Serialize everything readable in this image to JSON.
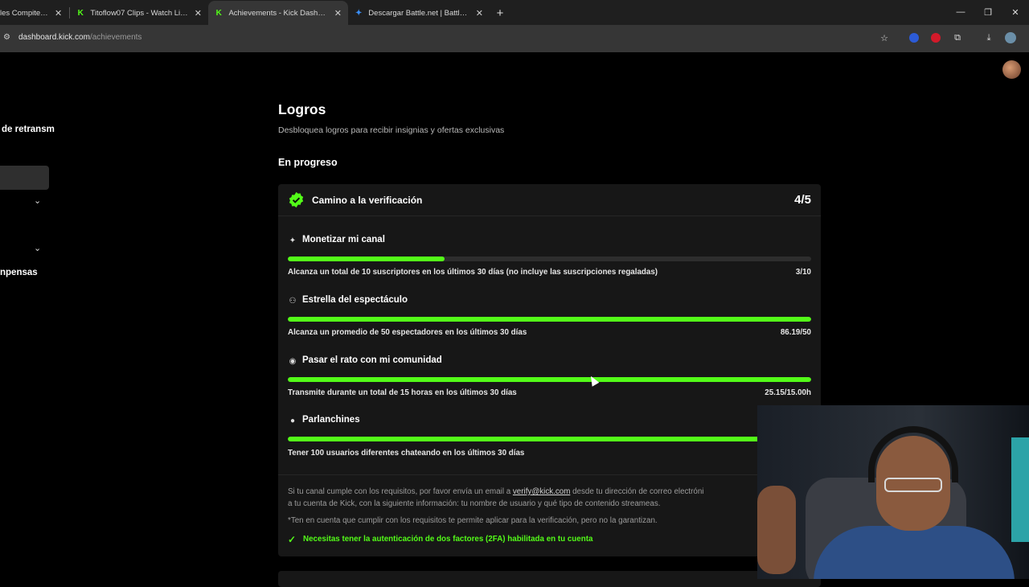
{
  "browser": {
    "tabs": [
      {
        "title": "les Compiten p",
        "active": false
      },
      {
        "title": "Titoflow07 Clips - Watch Live o",
        "active": false
      },
      {
        "title": "Achievements - Kick Dashboard",
        "active": true
      },
      {
        "title": "Descargar Battle.net | Battle.net",
        "active": false
      }
    ],
    "new_tab": "+",
    "url_host": "dashboard.kick.com",
    "url_path": "/achievements"
  },
  "sidebar": {
    "label1": "de retransm",
    "label2": "npensas"
  },
  "page": {
    "title": "Logros",
    "subtitle": "Desbloquea logros para recibir insignias y ofertas exclusivas",
    "section": "En progreso"
  },
  "card": {
    "title": "Camino a la verificación",
    "count": "4/5",
    "achievements": [
      {
        "name": "Monetizar mi canal",
        "icon": "sparkle-icon",
        "desc": "Alcanza un total de 10 suscriptores en los últimos 30 días (no incluye las suscripciones regaladas)",
        "value": "3/10",
        "progress": 0.3
      },
      {
        "name": "Estrella del espectáculo",
        "icon": "users-icon",
        "desc": "Alcanza un promedio de 50 espectadores en los últimos 30 días",
        "value": "86.19/50",
        "progress": 1.0
      },
      {
        "name": "Pasar el rato con mi comunidad",
        "icon": "broadcast-icon",
        "desc": "Transmite durante un total de 15 horas en los últimos 30 días",
        "value": "25.15/15.00h",
        "progress": 1.0
      },
      {
        "name": "Parlanchines",
        "icon": "chat-icon",
        "desc": "Tener 100 usuarios diferentes chateando en los últimos 30 días",
        "value": "",
        "progress": 1.0
      }
    ],
    "info_line1_a": "Si tu canal cumple con los requisitos, por favor envía un email a ",
    "info_email": "verify@kick.com",
    "info_line1_b": " desde tu dirección de correo electróni",
    "info_line2": "a tu cuenta de Kick, con la siguiente información: tu nombre de usuario y qué tipo de contenido streameas.",
    "info_line3": "*Ten en cuenta que cumplir con los requisitos te permite aplicar para la verificación, pero no la garantizan.",
    "requirement": "Necesitas tener la autenticación de dos factores (2FA) habilitada en tu cuenta"
  },
  "colors": {
    "accent": "#53fc18",
    "background": "#000000",
    "card": "#171717"
  }
}
